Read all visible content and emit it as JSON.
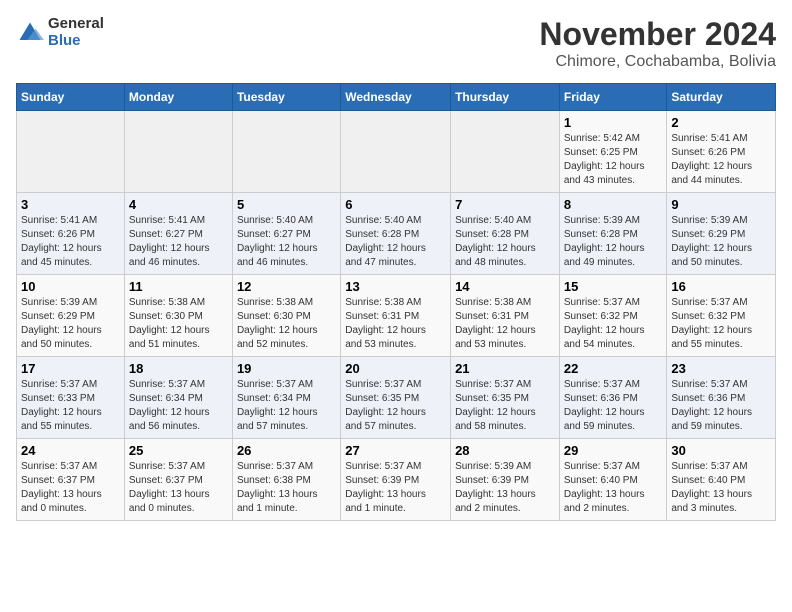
{
  "logo": {
    "general": "General",
    "blue": "Blue"
  },
  "header": {
    "month": "November 2024",
    "location": "Chimore, Cochabamba, Bolivia"
  },
  "weekdays": [
    "Sunday",
    "Monday",
    "Tuesday",
    "Wednesday",
    "Thursday",
    "Friday",
    "Saturday"
  ],
  "weeks": [
    [
      {
        "day": "",
        "info": ""
      },
      {
        "day": "",
        "info": ""
      },
      {
        "day": "",
        "info": ""
      },
      {
        "day": "",
        "info": ""
      },
      {
        "day": "",
        "info": ""
      },
      {
        "day": "1",
        "info": "Sunrise: 5:42 AM\nSunset: 6:25 PM\nDaylight: 12 hours\nand 43 minutes."
      },
      {
        "day": "2",
        "info": "Sunrise: 5:41 AM\nSunset: 6:26 PM\nDaylight: 12 hours\nand 44 minutes."
      }
    ],
    [
      {
        "day": "3",
        "info": "Sunrise: 5:41 AM\nSunset: 6:26 PM\nDaylight: 12 hours\nand 45 minutes."
      },
      {
        "day": "4",
        "info": "Sunrise: 5:41 AM\nSunset: 6:27 PM\nDaylight: 12 hours\nand 46 minutes."
      },
      {
        "day": "5",
        "info": "Sunrise: 5:40 AM\nSunset: 6:27 PM\nDaylight: 12 hours\nand 46 minutes."
      },
      {
        "day": "6",
        "info": "Sunrise: 5:40 AM\nSunset: 6:28 PM\nDaylight: 12 hours\nand 47 minutes."
      },
      {
        "day": "7",
        "info": "Sunrise: 5:40 AM\nSunset: 6:28 PM\nDaylight: 12 hours\nand 48 minutes."
      },
      {
        "day": "8",
        "info": "Sunrise: 5:39 AM\nSunset: 6:28 PM\nDaylight: 12 hours\nand 49 minutes."
      },
      {
        "day": "9",
        "info": "Sunrise: 5:39 AM\nSunset: 6:29 PM\nDaylight: 12 hours\nand 50 minutes."
      }
    ],
    [
      {
        "day": "10",
        "info": "Sunrise: 5:39 AM\nSunset: 6:29 PM\nDaylight: 12 hours\nand 50 minutes."
      },
      {
        "day": "11",
        "info": "Sunrise: 5:38 AM\nSunset: 6:30 PM\nDaylight: 12 hours\nand 51 minutes."
      },
      {
        "day": "12",
        "info": "Sunrise: 5:38 AM\nSunset: 6:30 PM\nDaylight: 12 hours\nand 52 minutes."
      },
      {
        "day": "13",
        "info": "Sunrise: 5:38 AM\nSunset: 6:31 PM\nDaylight: 12 hours\nand 53 minutes."
      },
      {
        "day": "14",
        "info": "Sunrise: 5:38 AM\nSunset: 6:31 PM\nDaylight: 12 hours\nand 53 minutes."
      },
      {
        "day": "15",
        "info": "Sunrise: 5:37 AM\nSunset: 6:32 PM\nDaylight: 12 hours\nand 54 minutes."
      },
      {
        "day": "16",
        "info": "Sunrise: 5:37 AM\nSunset: 6:32 PM\nDaylight: 12 hours\nand 55 minutes."
      }
    ],
    [
      {
        "day": "17",
        "info": "Sunrise: 5:37 AM\nSunset: 6:33 PM\nDaylight: 12 hours\nand 55 minutes."
      },
      {
        "day": "18",
        "info": "Sunrise: 5:37 AM\nSunset: 6:34 PM\nDaylight: 12 hours\nand 56 minutes."
      },
      {
        "day": "19",
        "info": "Sunrise: 5:37 AM\nSunset: 6:34 PM\nDaylight: 12 hours\nand 57 minutes."
      },
      {
        "day": "20",
        "info": "Sunrise: 5:37 AM\nSunset: 6:35 PM\nDaylight: 12 hours\nand 57 minutes."
      },
      {
        "day": "21",
        "info": "Sunrise: 5:37 AM\nSunset: 6:35 PM\nDaylight: 12 hours\nand 58 minutes."
      },
      {
        "day": "22",
        "info": "Sunrise: 5:37 AM\nSunset: 6:36 PM\nDaylight: 12 hours\nand 59 minutes."
      },
      {
        "day": "23",
        "info": "Sunrise: 5:37 AM\nSunset: 6:36 PM\nDaylight: 12 hours\nand 59 minutes."
      }
    ],
    [
      {
        "day": "24",
        "info": "Sunrise: 5:37 AM\nSunset: 6:37 PM\nDaylight: 13 hours\nand 0 minutes."
      },
      {
        "day": "25",
        "info": "Sunrise: 5:37 AM\nSunset: 6:37 PM\nDaylight: 13 hours\nand 0 minutes."
      },
      {
        "day": "26",
        "info": "Sunrise: 5:37 AM\nSunset: 6:38 PM\nDaylight: 13 hours\nand 1 minute."
      },
      {
        "day": "27",
        "info": "Sunrise: 5:37 AM\nSunset: 6:39 PM\nDaylight: 13 hours\nand 1 minute."
      },
      {
        "day": "28",
        "info": "Sunrise: 5:39 AM\nSunset: 6:39 PM\nDaylight: 13 hours\nand 2 minutes."
      },
      {
        "day": "29",
        "info": "Sunrise: 5:37 AM\nSunset: 6:40 PM\nDaylight: 13 hours\nand 2 minutes."
      },
      {
        "day": "30",
        "info": "Sunrise: 5:37 AM\nSunset: 6:40 PM\nDaylight: 13 hours\nand 3 minutes."
      }
    ]
  ]
}
